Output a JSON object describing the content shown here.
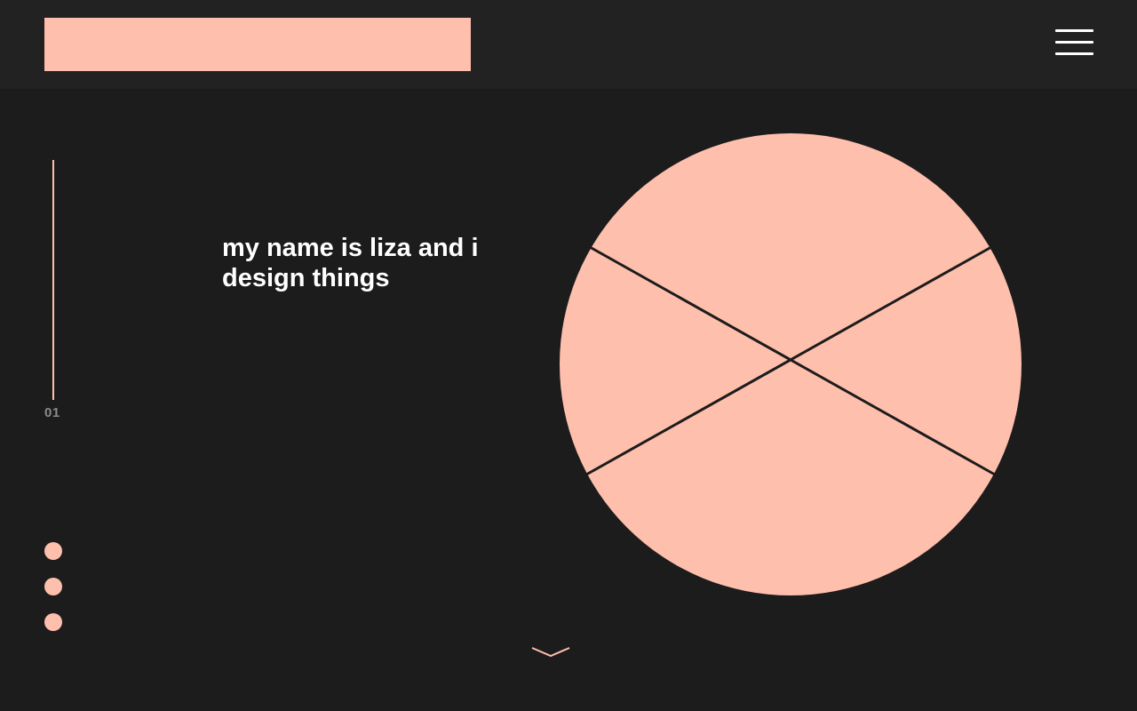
{
  "colors": {
    "accent": "#ffbfad",
    "background": "#1c1c1c",
    "header_background": "#222222",
    "text": "#ffffff",
    "muted_text": "#8a8a8a",
    "line_dark": "#1c1c1c"
  },
  "header": {
    "logo_icon": "logo-placeholder",
    "menu_icon": "hamburger-menu-icon"
  },
  "section": {
    "number": "01"
  },
  "hero": {
    "headline": "my name is liza and i design things",
    "graphic_icon": "circle-x-graphic"
  },
  "slide_dots": {
    "count": 3
  },
  "scroll_indicator": {
    "icon": "chevron-down-icon"
  }
}
